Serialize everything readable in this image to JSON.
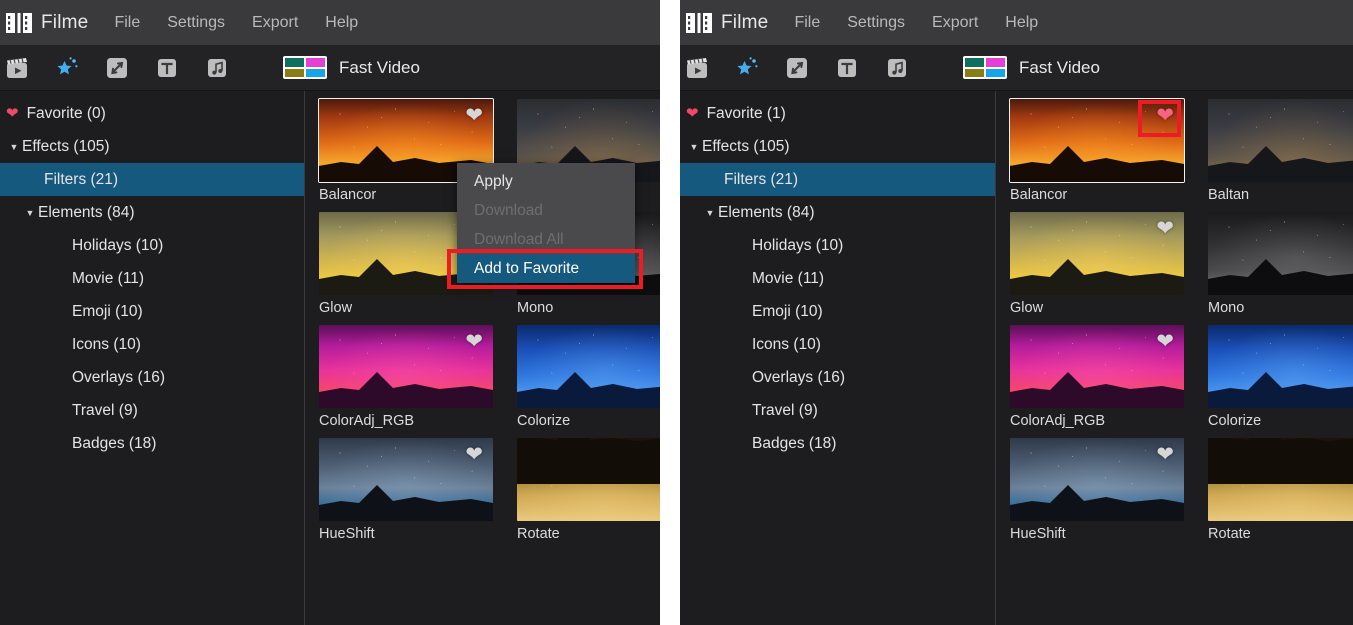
{
  "app": {
    "brand": "Filme",
    "logo_icon": "film-strip-icon",
    "menu": [
      {
        "label": "File"
      },
      {
        "label": "Settings"
      },
      {
        "label": "Export"
      },
      {
        "label": "Help"
      }
    ]
  },
  "toolbar": {
    "buttons": [
      {
        "name": "media-icon",
        "glyph": "media"
      },
      {
        "name": "effects-icon",
        "glyph": "magic-star"
      },
      {
        "name": "transition-icon",
        "glyph": "transition"
      },
      {
        "name": "text-icon",
        "glyph": "text"
      },
      {
        "name": "audio-icon",
        "glyph": "music-note"
      }
    ],
    "fast_video_label": "Fast Video",
    "fast_video_icon": "fast-video-icon"
  },
  "sidebar_left": {
    "favorite": {
      "label": "Favorite (0)",
      "icon": "heart-icon"
    },
    "effects": {
      "label": "Effects (105)",
      "caret": "▼"
    },
    "filters": {
      "label": "Filters (21)",
      "selected": true
    },
    "elements": {
      "label": "Elements (84)",
      "caret": "▼"
    },
    "children": [
      {
        "label": "Holidays (10)"
      },
      {
        "label": "Movie (11)"
      },
      {
        "label": "Emoji (10)"
      },
      {
        "label": "Icons (10)"
      },
      {
        "label": "Overlays (16)"
      },
      {
        "label": "Travel (9)"
      },
      {
        "label": "Badges (18)"
      }
    ]
  },
  "sidebar_right": {
    "favorite": {
      "label": "Favorite (1)",
      "icon": "heart-icon"
    },
    "effects": {
      "label": "Effects (105)",
      "caret": "▼"
    },
    "filters": {
      "label": "Filters (21)",
      "selected": true
    },
    "elements": {
      "label": "Elements (84)",
      "caret": "▼"
    },
    "children": [
      {
        "label": "Holidays (10)"
      },
      {
        "label": "Movie (11)"
      },
      {
        "label": "Emoji (10)"
      },
      {
        "label": "Icons (10)"
      },
      {
        "label": "Overlays (16)"
      },
      {
        "label": "Travel (9)"
      },
      {
        "label": "Badges (18)"
      }
    ]
  },
  "grid_left": {
    "items": [
      {
        "label": "Balancor",
        "selected": true,
        "favorited": false,
        "style": "orange"
      },
      {
        "label": "Baltan",
        "selected": false,
        "favorited": false,
        "style": "greysky"
      },
      {
        "label": "Glow",
        "selected": false,
        "favorited": false,
        "style": "gold"
      },
      {
        "label": "Mono",
        "selected": false,
        "favorited": false,
        "style": "mono"
      },
      {
        "label": "ColorAdj_RGB",
        "selected": false,
        "favorited": false,
        "style": "magenta"
      },
      {
        "label": "Colorize",
        "selected": false,
        "favorited": false,
        "style": "blue"
      },
      {
        "label": "HueShift",
        "selected": false,
        "favorited": false,
        "style": "steel"
      },
      {
        "label": "Rotate",
        "selected": false,
        "favorited": false,
        "style": "rotate"
      }
    ]
  },
  "grid_right": {
    "items": [
      {
        "label": "Balancor",
        "selected": true,
        "favorited": true,
        "highlighted": true,
        "style": "orange"
      },
      {
        "label": "Baltan",
        "selected": false,
        "favorited": false,
        "style": "greysky"
      },
      {
        "label": "Glow",
        "selected": false,
        "favorited": false,
        "style": "gold"
      },
      {
        "label": "Mono",
        "selected": false,
        "favorited": false,
        "style": "mono"
      },
      {
        "label": "ColorAdj_RGB",
        "selected": false,
        "favorited": false,
        "style": "magenta"
      },
      {
        "label": "Colorize",
        "selected": false,
        "favorited": false,
        "style": "blue"
      },
      {
        "label": "HueShift",
        "selected": false,
        "favorited": false,
        "style": "steel"
      },
      {
        "label": "Rotate",
        "selected": false,
        "favorited": false,
        "style": "rotate"
      }
    ]
  },
  "context_menu": {
    "items": [
      {
        "label": "Apply",
        "state": "enabled"
      },
      {
        "label": "Download",
        "state": "disabled"
      },
      {
        "label": "Download All",
        "state": "disabled"
      },
      {
        "label": "Add to Favorite",
        "state": "highlighted"
      }
    ]
  },
  "colors": {
    "accent_selected": "#15597f",
    "panel_bg": "#1d1d1f",
    "menubar_bg": "#3a3a3c",
    "toolbar_bg": "#232325",
    "heart_active": "#f4657f",
    "heart_inactive": "#d6d6d6",
    "annotation_red": "#ec1c24",
    "context_menu_bg": "#4a4a4c"
  }
}
